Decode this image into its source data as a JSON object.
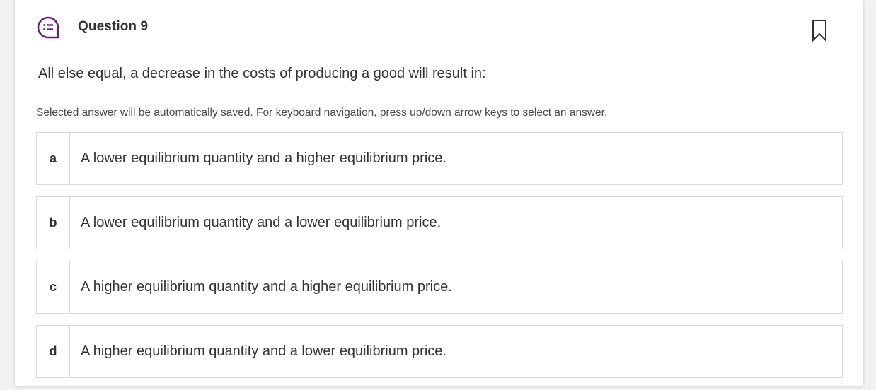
{
  "question": {
    "title": "Question 9",
    "prompt": "All else equal, a decrease in the costs of producing a good will result in:",
    "hint": "Selected answer will be automatically saved. For keyboard navigation, press up/down arrow keys to select an answer.",
    "icon": "question-chat-icon",
    "bookmark_icon": "bookmark-icon"
  },
  "answers": [
    {
      "letter": "a",
      "text": "A lower equilibrium quantity and a higher equilibrium price."
    },
    {
      "letter": "b",
      "text": "A lower equilibrium quantity and a lower equilibrium price."
    },
    {
      "letter": "c",
      "text": "A higher equilibrium quantity and a higher equilibrium price."
    },
    {
      "letter": "d",
      "text": "A higher equilibrium quantity and a lower equilibrium price."
    }
  ],
  "colors": {
    "accent": "#6b1f7a",
    "border": "#d9d9d9",
    "text": "#333333"
  }
}
